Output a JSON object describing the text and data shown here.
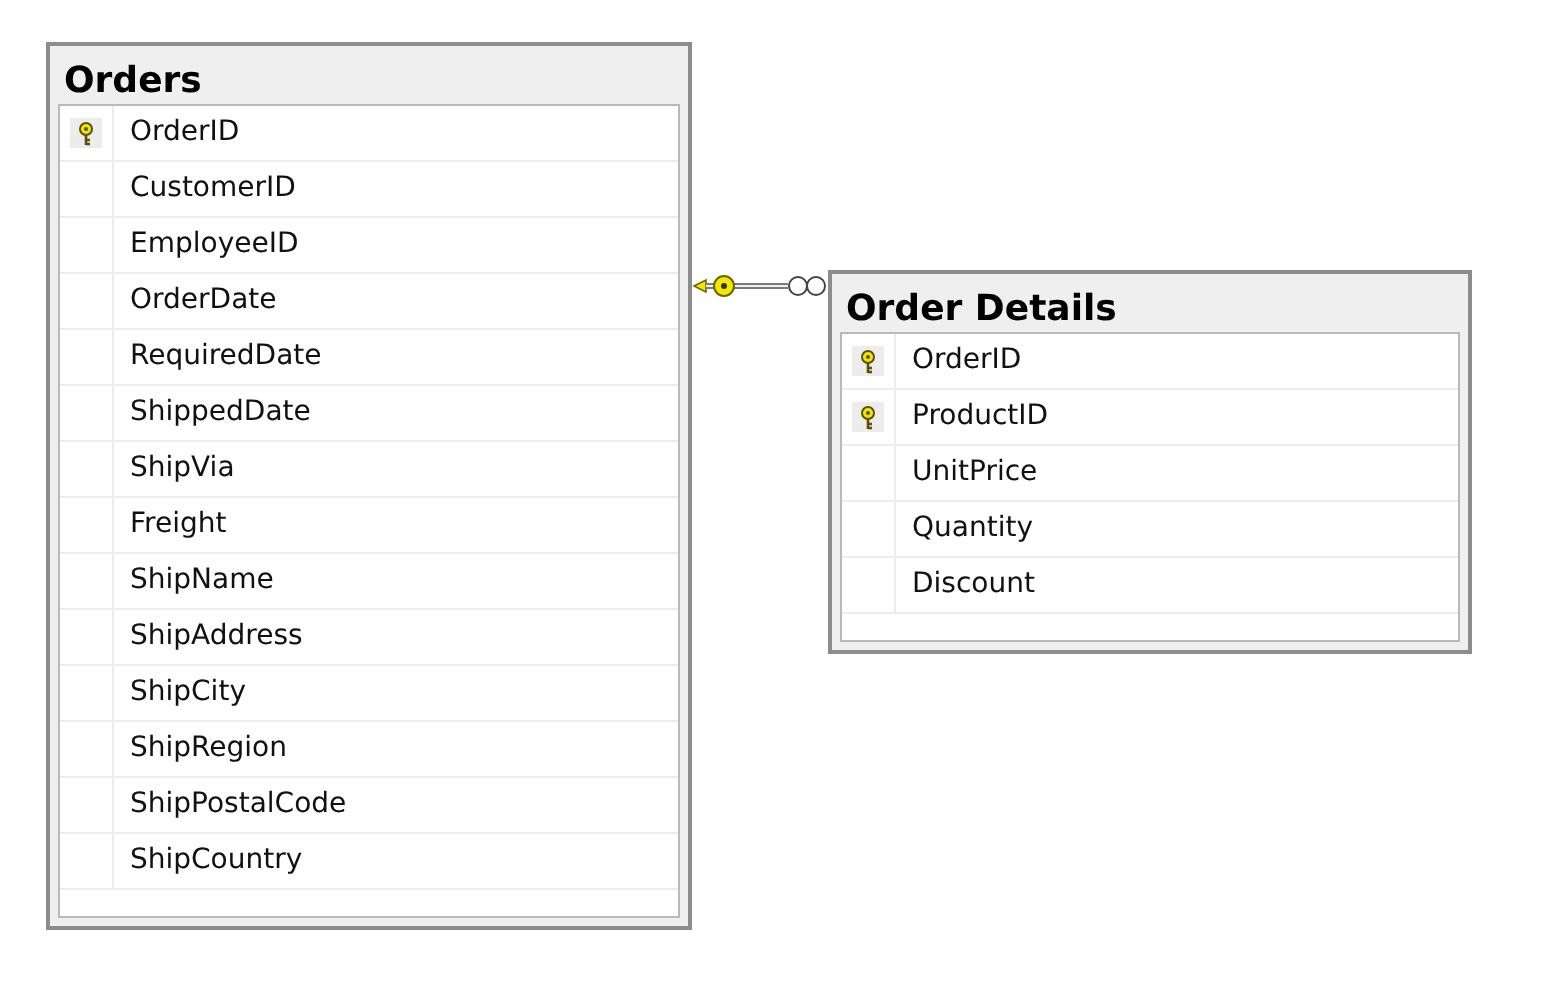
{
  "tables": [
    {
      "title": "Orders",
      "columns": [
        {
          "name": "OrderID",
          "primary_key": true
        },
        {
          "name": "CustomerID",
          "primary_key": false
        },
        {
          "name": "EmployeeID",
          "primary_key": false
        },
        {
          "name": "OrderDate",
          "primary_key": false
        },
        {
          "name": "RequiredDate",
          "primary_key": false
        },
        {
          "name": "ShippedDate",
          "primary_key": false
        },
        {
          "name": "ShipVia",
          "primary_key": false
        },
        {
          "name": "Freight",
          "primary_key": false
        },
        {
          "name": "ShipName",
          "primary_key": false
        },
        {
          "name": "ShipAddress",
          "primary_key": false
        },
        {
          "name": "ShipCity",
          "primary_key": false
        },
        {
          "name": "ShipRegion",
          "primary_key": false
        },
        {
          "name": "ShipPostalCode",
          "primary_key": false
        },
        {
          "name": "ShipCountry",
          "primary_key": false
        }
      ]
    },
    {
      "title": "Order Details",
      "columns": [
        {
          "name": "OrderID",
          "primary_key": true
        },
        {
          "name": "ProductID",
          "primary_key": true
        },
        {
          "name": "UnitPrice",
          "primary_key": false
        },
        {
          "name": "Quantity",
          "primary_key": false
        },
        {
          "name": "Discount",
          "primary_key": false
        }
      ]
    }
  ]
}
